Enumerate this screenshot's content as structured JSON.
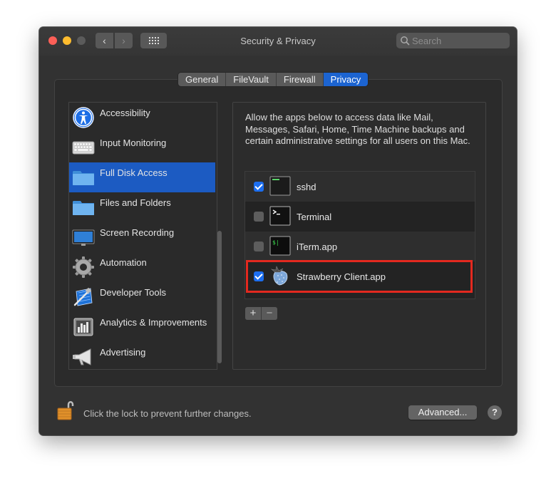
{
  "window": {
    "title": "Security & Privacy",
    "search_placeholder": "Search"
  },
  "tabs": [
    {
      "label": "General",
      "active": false
    },
    {
      "label": "FileVault",
      "active": false
    },
    {
      "label": "Firewall",
      "active": false
    },
    {
      "label": "Privacy",
      "active": true
    }
  ],
  "sidebar": {
    "items": [
      {
        "label": "Accessibility",
        "icon": "accessibility-icon",
        "selected": false
      },
      {
        "label": "Input Monitoring",
        "icon": "keyboard-icon",
        "selected": false
      },
      {
        "label": "Full Disk Access",
        "icon": "folder-icon",
        "selected": true
      },
      {
        "label": "Files and Folders",
        "icon": "folder-icon",
        "selected": false
      },
      {
        "label": "Screen Recording",
        "icon": "display-icon",
        "selected": false
      },
      {
        "label": "Automation",
        "icon": "gear-icon",
        "selected": false
      },
      {
        "label": "Developer Tools",
        "icon": "developer-tools-icon",
        "selected": false
      },
      {
        "label": "Analytics & Improvements",
        "icon": "analytics-icon",
        "selected": false
      },
      {
        "label": "Advertising",
        "icon": "megaphone-icon",
        "selected": false
      }
    ]
  },
  "main": {
    "description": "Allow the apps below to access data like Mail, Messages, Safari, Home, Time Machine backups and certain administrative settings for all users on this Mac.",
    "apps": [
      {
        "label": "sshd",
        "checked": true,
        "icon": "terminal-exec-icon"
      },
      {
        "label": "Terminal",
        "checked": false,
        "icon": "terminal-icon"
      },
      {
        "label": "iTerm.app",
        "checked": false,
        "icon": "iterm-icon"
      },
      {
        "label": "Strawberry Client.app",
        "checked": true,
        "icon": "strawberry-icon"
      }
    ],
    "add_label": "+",
    "remove_label": "−"
  },
  "footer": {
    "lock_text": "Click the lock to prevent further changes.",
    "advanced_label": "Advanced...",
    "help_label": "?"
  },
  "colors": {
    "accent": "#1c64d1",
    "highlight_box": "#e3291f"
  }
}
